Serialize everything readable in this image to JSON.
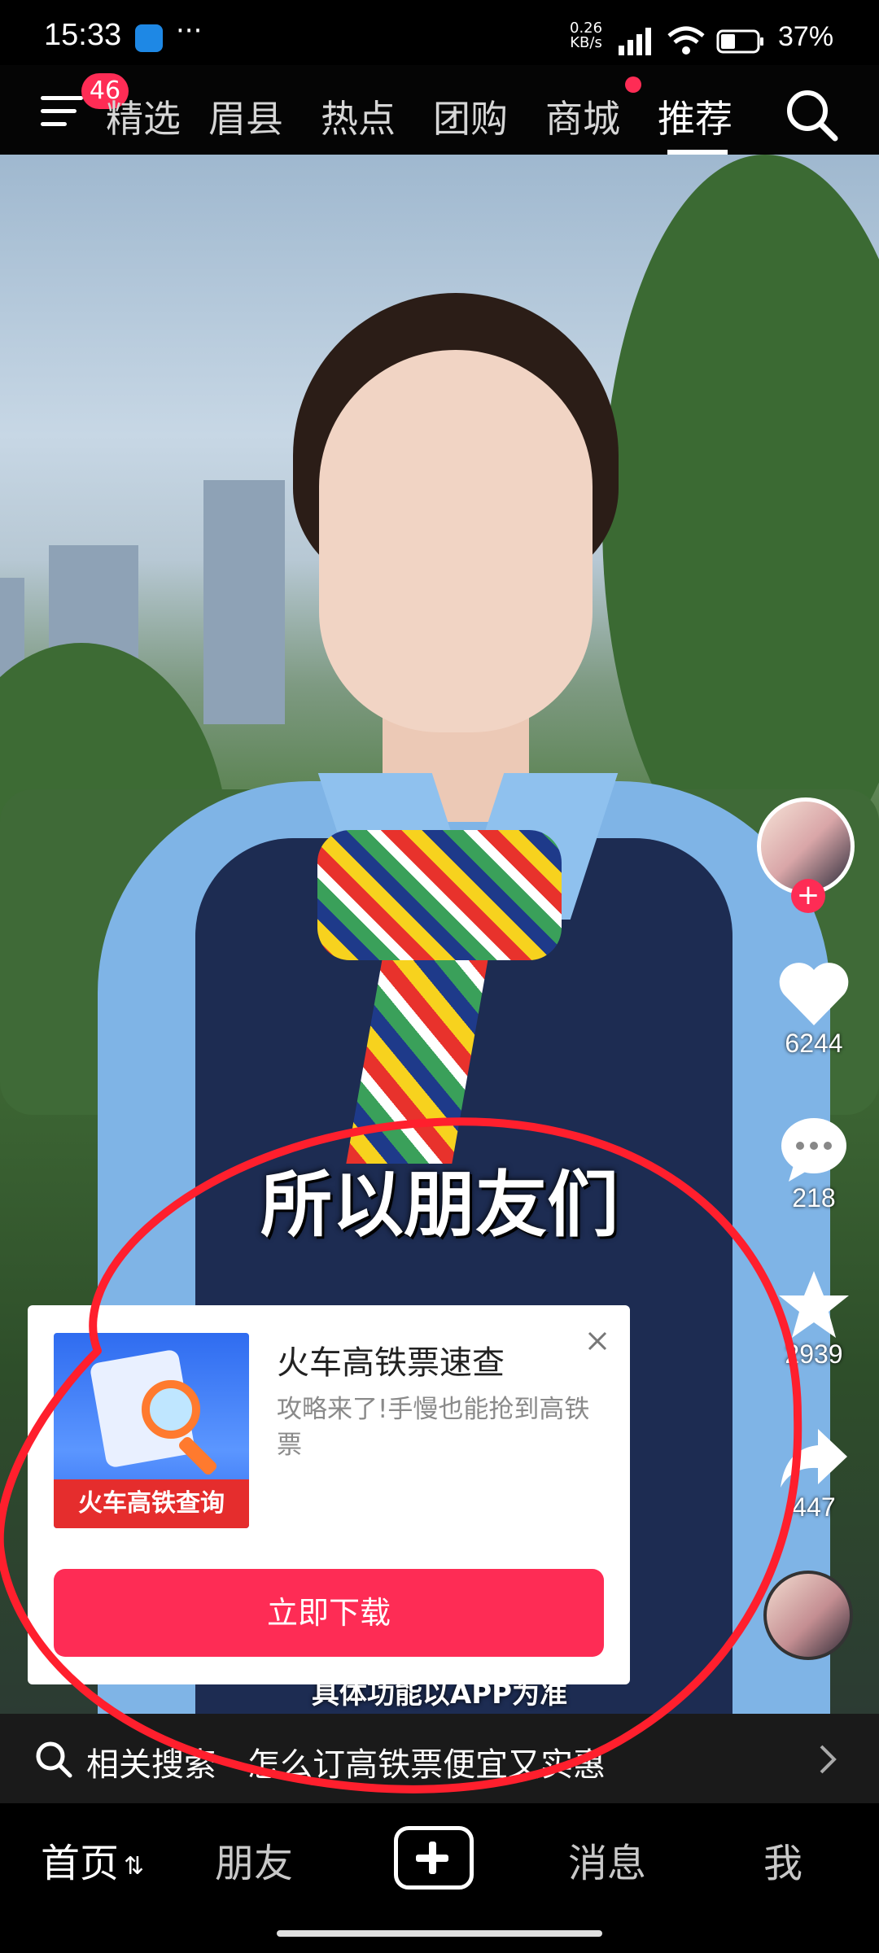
{
  "status_bar": {
    "time": "15:33",
    "more": "···",
    "net_speed": "0.26",
    "net_unit": "KB/s",
    "battery": "37%"
  },
  "top_nav": {
    "badge_count": "46",
    "tabs": [
      {
        "label": "精选"
      },
      {
        "label": "眉县"
      },
      {
        "label": "热点"
      },
      {
        "label": "团购"
      },
      {
        "label": "商城"
      },
      {
        "label": "推荐"
      }
    ],
    "active_tab": "推荐"
  },
  "video": {
    "caption": "所以朋友们",
    "subcaption": "具体功能以APP为准"
  },
  "side_actions": {
    "likes": "6244",
    "comments": "218",
    "favorites": "2939",
    "shares": "447"
  },
  "ad": {
    "thumb_label": "火车高铁查询",
    "title": "火车高铁票速查",
    "description": "攻略来了!手慢也能抢到高铁票",
    "cta": "立即下载"
  },
  "related_search": {
    "text": "相关搜索 · 怎么订高铁票便宜又实惠"
  },
  "bottom_nav": {
    "home": "首页",
    "friends": "朋友",
    "messages": "消息",
    "me": "我"
  },
  "colors": {
    "accent": "#fe2c55",
    "annotation": "#ff1f2d"
  }
}
